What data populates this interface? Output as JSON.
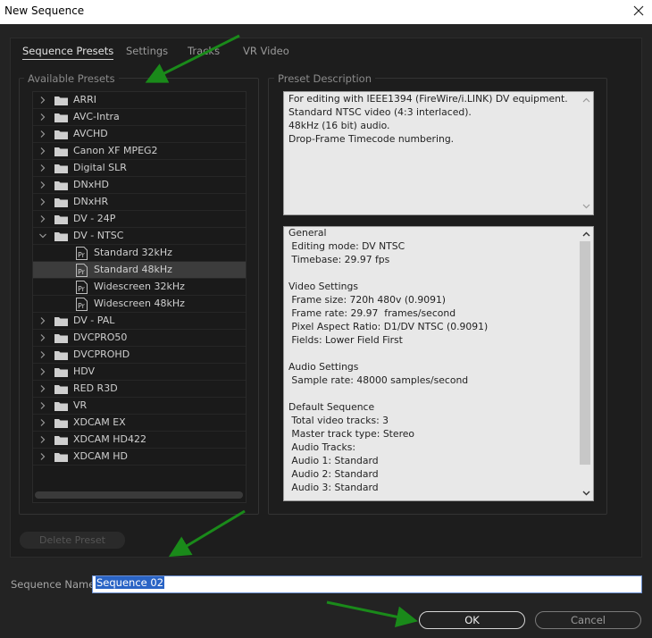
{
  "window": {
    "title": "New Sequence"
  },
  "tabs": [
    {
      "label": "Sequence Presets",
      "active": true
    },
    {
      "label": "Settings",
      "active": false
    },
    {
      "label": "Tracks",
      "active": false
    },
    {
      "label": "VR Video",
      "active": false
    }
  ],
  "available_presets": {
    "label": "Available Presets",
    "items": [
      {
        "label": "ARRI",
        "kind": "folder",
        "expanded": false
      },
      {
        "label": "AVC-Intra",
        "kind": "folder",
        "expanded": false
      },
      {
        "label": "AVCHD",
        "kind": "folder",
        "expanded": false
      },
      {
        "label": "Canon XF MPEG2",
        "kind": "folder",
        "expanded": false
      },
      {
        "label": "Digital SLR",
        "kind": "folder",
        "expanded": false
      },
      {
        "label": "DNxHD",
        "kind": "folder",
        "expanded": false
      },
      {
        "label": "DNxHR",
        "kind": "folder",
        "expanded": false
      },
      {
        "label": "DV - 24P",
        "kind": "folder",
        "expanded": false
      },
      {
        "label": "DV - NTSC",
        "kind": "folder",
        "expanded": true
      },
      {
        "label": "Standard 32kHz",
        "kind": "preset"
      },
      {
        "label": "Standard 48kHz",
        "kind": "preset",
        "selected": true
      },
      {
        "label": "Widescreen 32kHz",
        "kind": "preset"
      },
      {
        "label": "Widescreen 48kHz",
        "kind": "preset"
      },
      {
        "label": "DV - PAL",
        "kind": "folder",
        "expanded": false
      },
      {
        "label": "DVCPRO50",
        "kind": "folder",
        "expanded": false
      },
      {
        "label": "DVCPROHD",
        "kind": "folder",
        "expanded": false
      },
      {
        "label": "HDV",
        "kind": "folder",
        "expanded": false
      },
      {
        "label": "RED R3D",
        "kind": "folder",
        "expanded": false
      },
      {
        "label": "VR",
        "kind": "folder",
        "expanded": false
      },
      {
        "label": "XDCAM EX",
        "kind": "folder",
        "expanded": false
      },
      {
        "label": "XDCAM HD422",
        "kind": "folder",
        "expanded": false
      },
      {
        "label": "XDCAM HD",
        "kind": "folder",
        "expanded": false
      }
    ]
  },
  "preset_description": {
    "label": "Preset Description",
    "summary": [
      "For editing with IEEE1394 (FireWire/i.LINK) DV equipment.",
      "Standard NTSC video (4:3 interlaced).",
      "48kHz (16 bit) audio.",
      "Drop-Frame Timecode numbering."
    ],
    "details": [
      "General",
      " Editing mode: DV NTSC",
      " Timebase: 29.97 fps",
      "",
      "Video Settings",
      " Frame size: 720h 480v (0.9091)",
      " Frame rate: 29.97  frames/second",
      " Pixel Aspect Ratio: D1/DV NTSC (0.9091)",
      " Fields: Lower Field First",
      "",
      "Audio Settings",
      " Sample rate: 48000 samples/second",
      "",
      "Default Sequence",
      " Total video tracks: 3",
      " Master track type: Stereo",
      " Audio Tracks:",
      " Audio 1: Standard",
      " Audio 2: Standard",
      " Audio 3: Standard"
    ]
  },
  "delete_preset": {
    "label": "Delete Preset"
  },
  "sequence_name": {
    "label": "Sequence Name:",
    "value": "Sequence 02"
  },
  "buttons": {
    "ok": "OK",
    "cancel": "Cancel"
  },
  "colors": {
    "annotation_arrow": "#1a8a1a",
    "selection": "#2a64c5",
    "panel_bg": "#1d1d1d"
  }
}
